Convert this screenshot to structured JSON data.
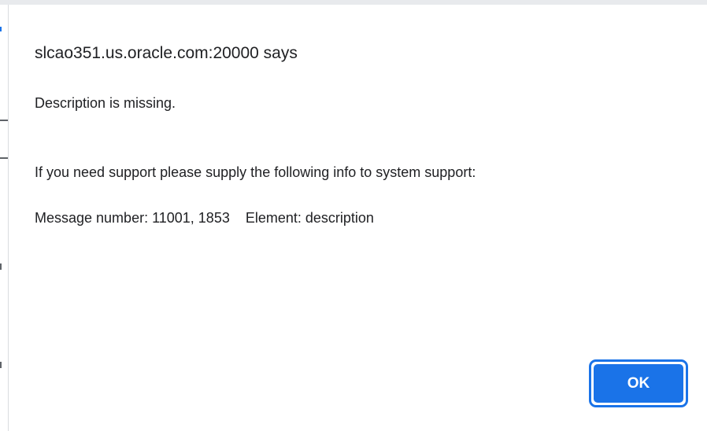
{
  "dialog": {
    "title": "slcao351.us.oracle.com:20000 says",
    "message_lines": [
      "Description is missing.",
      "",
      "",
      "If you need support please supply the following info to system support:",
      "",
      "Message number: 11001, 1853    Element: description"
    ],
    "ok_label": "OK"
  },
  "colors": {
    "accent": "#1a73e8",
    "text": "#202124",
    "background": "#ffffff"
  }
}
